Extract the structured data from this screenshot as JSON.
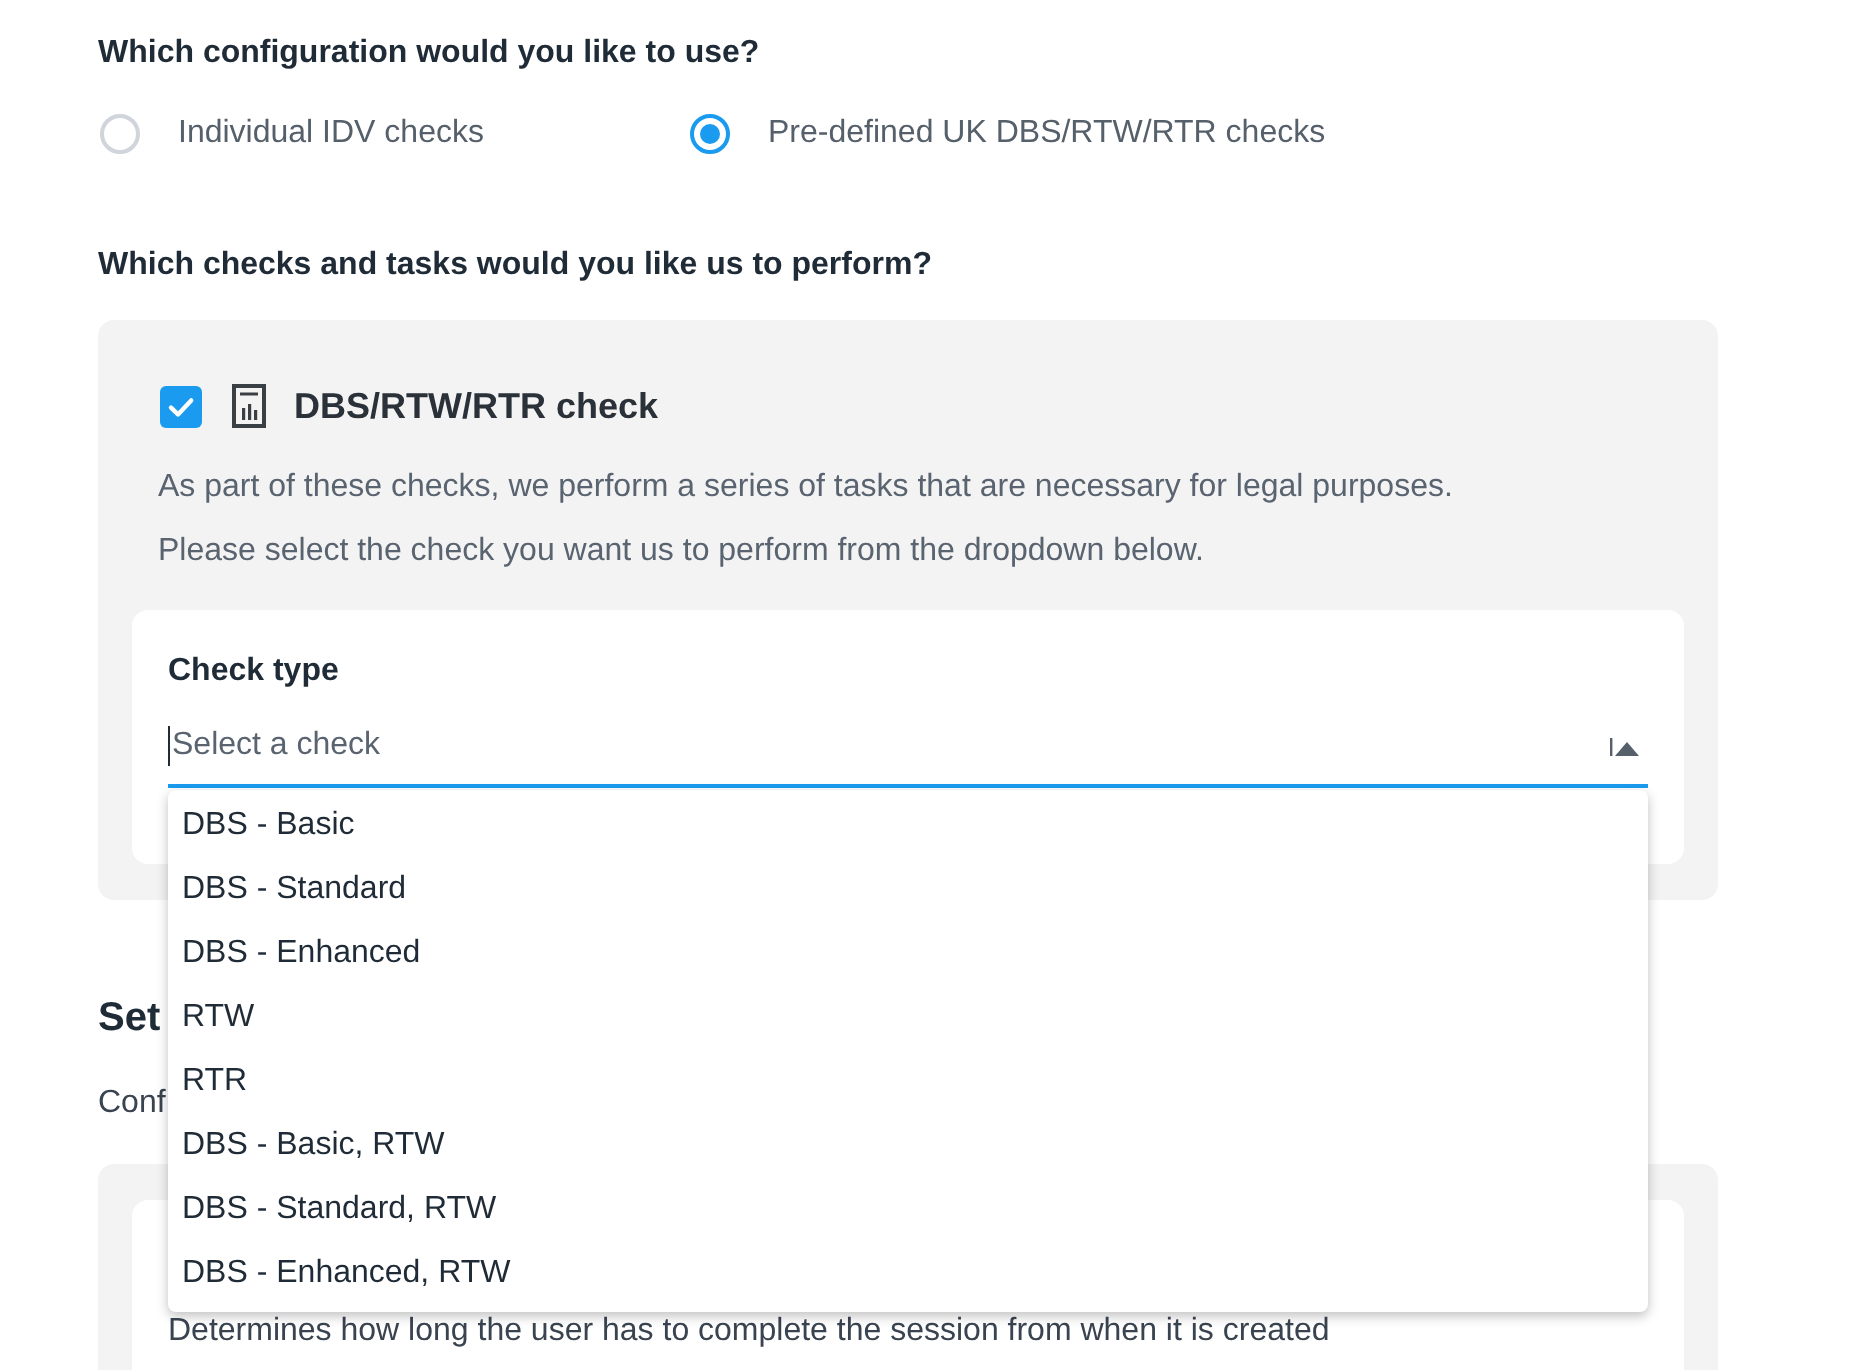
{
  "configuration": {
    "question": "Which configuration would you like to use?",
    "options": [
      {
        "label": "Individual IDV checks",
        "selected": false
      },
      {
        "label": "Pre-defined UK DBS/RTW/RTR checks",
        "selected": true
      }
    ]
  },
  "checks": {
    "question": "Which checks and tasks would you like us to perform?",
    "check": {
      "title": "DBS/RTW/RTR check",
      "checked": true,
      "description": [
        "As part of these checks, we perform a series of tasks that are necessary for legal purposes.",
        "Please select the check you want us to perform from the dropdown below."
      ],
      "check_type": {
        "label": "Check type",
        "placeholder": "Select a check",
        "focused": true,
        "expanded": true,
        "options": [
          {
            "label": "DBS - Basic",
            "selected": false
          },
          {
            "label": "DBS - Standard",
            "selected": false
          },
          {
            "label": "DBS - Enhanced",
            "selected": false
          },
          {
            "label": "RTW",
            "selected": false
          },
          {
            "label": "RTR",
            "selected": false
          },
          {
            "label": "DBS - Basic, RTW",
            "selected": false
          },
          {
            "label": "DBS - Standard, RTW",
            "selected": false
          },
          {
            "label": "DBS - Enhanced, RTW",
            "selected": false
          }
        ]
      }
    }
  },
  "section_2": {
    "heading": "Set",
    "text": "Conf",
    "card": {
      "description": "Determines how long the user has to complete the session from when it is created"
    }
  }
}
